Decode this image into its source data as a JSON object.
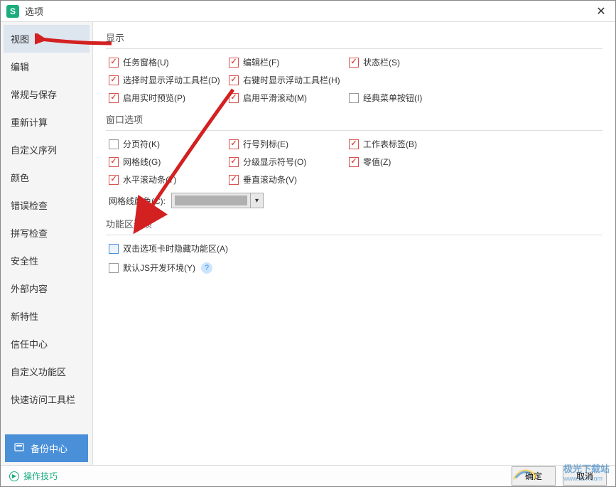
{
  "window": {
    "title": "选项",
    "app_icon_letter": "S"
  },
  "sidebar": {
    "items": [
      {
        "label": "视图",
        "selected": true
      },
      {
        "label": "编辑",
        "selected": false
      },
      {
        "label": "常规与保存",
        "selected": false
      },
      {
        "label": "重新计算",
        "selected": false
      },
      {
        "label": "自定义序列",
        "selected": false
      },
      {
        "label": "颜色",
        "selected": false
      },
      {
        "label": "错误检查",
        "selected": false
      },
      {
        "label": "拼写检查",
        "selected": false
      },
      {
        "label": "安全性",
        "selected": false
      },
      {
        "label": "外部内容",
        "selected": false
      },
      {
        "label": "新特性",
        "selected": false
      },
      {
        "label": "信任中心",
        "selected": false
      },
      {
        "label": "自定义功能区",
        "selected": false
      },
      {
        "label": "快速访问工具栏",
        "selected": false
      }
    ],
    "backup_label": "备份中心"
  },
  "sections": {
    "display": {
      "title": "显示",
      "items": [
        {
          "label": "任务窗格(U)",
          "checked": true
        },
        {
          "label": "编辑栏(F)",
          "checked": true
        },
        {
          "label": "状态栏(S)",
          "checked": true
        },
        {
          "label": "选择时显示浮动工具栏(D)",
          "checked": true
        },
        {
          "label": "右键时显示浮动工具栏(H)",
          "checked": true
        },
        {
          "label": "",
          "checked": false,
          "empty": true
        },
        {
          "label": "启用实时预览(P)",
          "checked": true
        },
        {
          "label": "启用平滑滚动(M)",
          "checked": true
        },
        {
          "label": "经典菜单按钮(I)",
          "checked": false
        }
      ]
    },
    "window": {
      "title": "窗口选项",
      "items": [
        {
          "label": "分页符(K)",
          "checked": false
        },
        {
          "label": "行号列标(E)",
          "checked": true
        },
        {
          "label": "工作表标签(B)",
          "checked": true
        },
        {
          "label": "网格线(G)",
          "checked": true
        },
        {
          "label": "分级显示符号(O)",
          "checked": true
        },
        {
          "label": "零值(Z)",
          "checked": true
        },
        {
          "label": "水平滚动条(T)",
          "checked": true
        },
        {
          "label": "垂直滚动条(V)",
          "checked": true
        }
      ],
      "grid_color_label": "网格线颜色(C):"
    },
    "ribbon": {
      "title": "功能区选项",
      "items": [
        {
          "label": "双击选项卡时隐藏功能区(A)",
          "checked": false,
          "highlight": true
        },
        {
          "label": "默认JS开发环境(Y)",
          "checked": false,
          "help": true
        }
      ]
    }
  },
  "footer": {
    "tips_label": "操作技巧",
    "ok_label": "确定",
    "cancel_label": "取消"
  },
  "watermark": {
    "text": "极光下载站",
    "url": "www.xz7.com"
  }
}
